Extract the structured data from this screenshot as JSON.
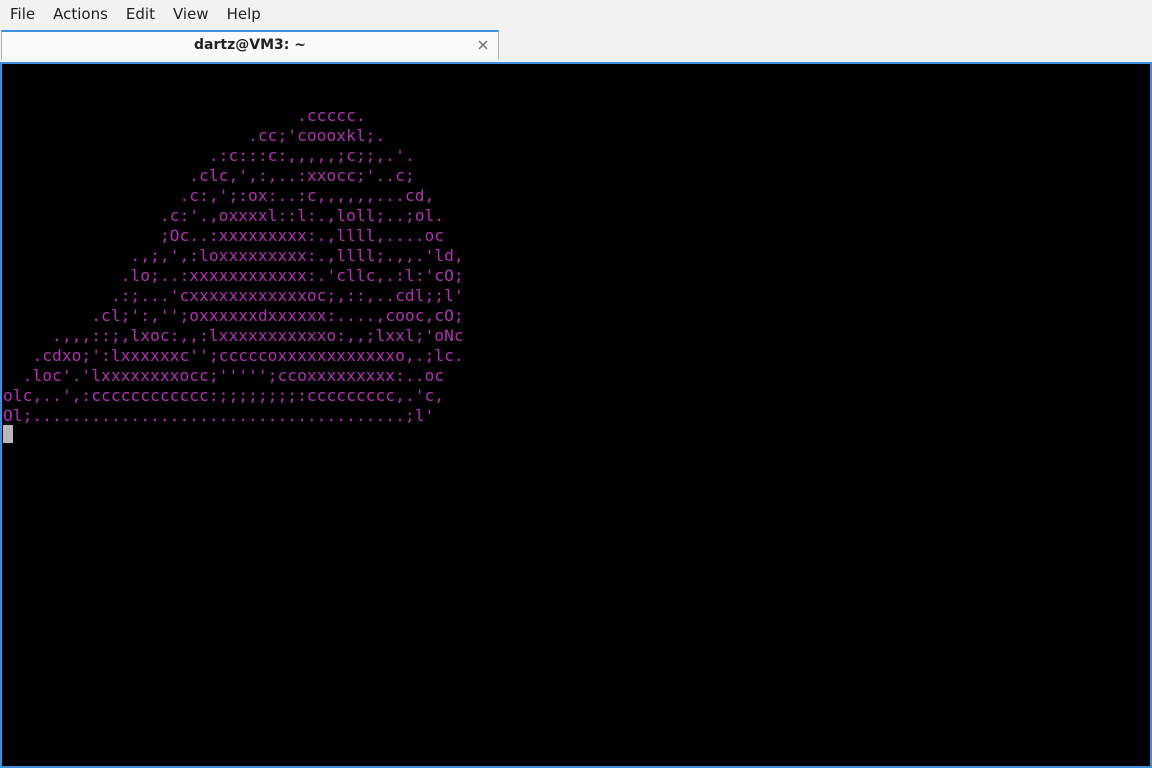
{
  "menubar": {
    "items": [
      "File",
      "Actions",
      "Edit",
      "View",
      "Help"
    ]
  },
  "tab": {
    "title": "dartz@VM3: ~",
    "close_icon": "close-icon"
  },
  "terminal": {
    "text_color": "#b030b0",
    "background": "#000000",
    "lines": [
      "                              .ccccc.",
      "                         .cc;'coooxkl;.",
      "                     .:c:::c:,,,,,;c;;,.'.",
      "                   .clc,',:,..:xxocc;'..c;",
      "                  .c:,';:ox:..:c,,,,,,...cd,",
      "                .c:'.,oxxxxl::l:.,loll;..;ol.",
      "                ;Oc..:xxxxxxxxx:.,llll,....oc",
      "             .,;,',:loxxxxxxxxx:.,llll;.,,.'ld,",
      "            .lo;..:xxxxxxxxxxxx:.'cllc,.:l:'cO;",
      "           .:;...'cxxxxxxxxxxxxoc;,::,..cdl;;l'",
      "         .cl;':,'';oxxxxxxdxxxxxx:....,cooc,cO;",
      "     .,,,::;,lxoc:,,:lxxxxxxxxxxxo:,,;lxxl;'oNc",
      "   .cdxo;':lxxxxxxc'';cccccoxxxxxxxxxxxxo,.;lc.",
      "  .loc'.'lxxxxxxxxocc;''''';ccoxxxxxxxxx:..oc",
      "olc,..',:cccccccccccc:;;;;;;;;:ccccccccc,.'c,",
      "Ol;......................................;l'"
    ]
  }
}
